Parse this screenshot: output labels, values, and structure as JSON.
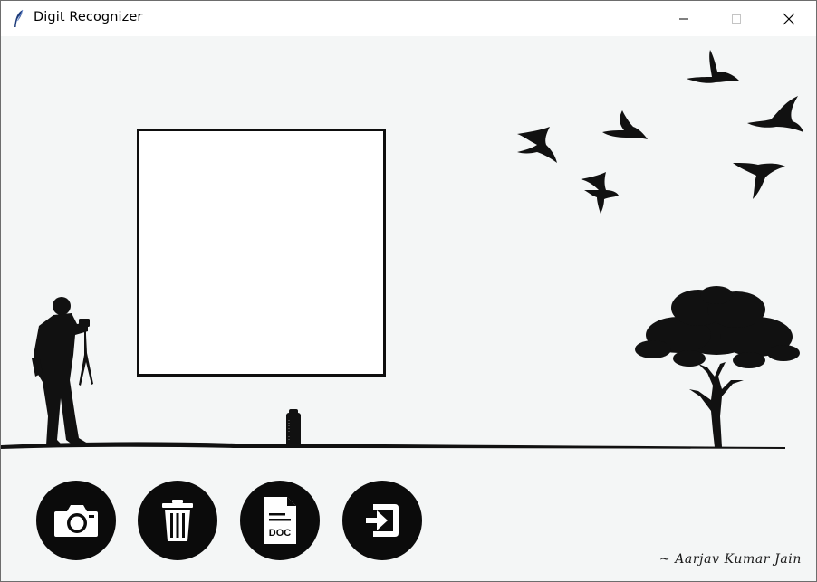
{
  "window": {
    "title": "Digit Recognizer",
    "minimize_glyph": "—",
    "close_glyph": "✕"
  },
  "toolbar": {
    "buttons": [
      {
        "id": "capture",
        "icon": "camera-icon"
      },
      {
        "id": "clear",
        "icon": "trash-icon"
      },
      {
        "id": "document",
        "icon": "doc-file-icon",
        "label": "DOC"
      },
      {
        "id": "exit",
        "icon": "exit-icon"
      }
    ]
  },
  "footer": {
    "credit": "~ Aarjav Kumar Jain"
  },
  "colors": {
    "background": "#f4f6f6",
    "silhouette": "#111111",
    "canvas": "#ffffff"
  }
}
